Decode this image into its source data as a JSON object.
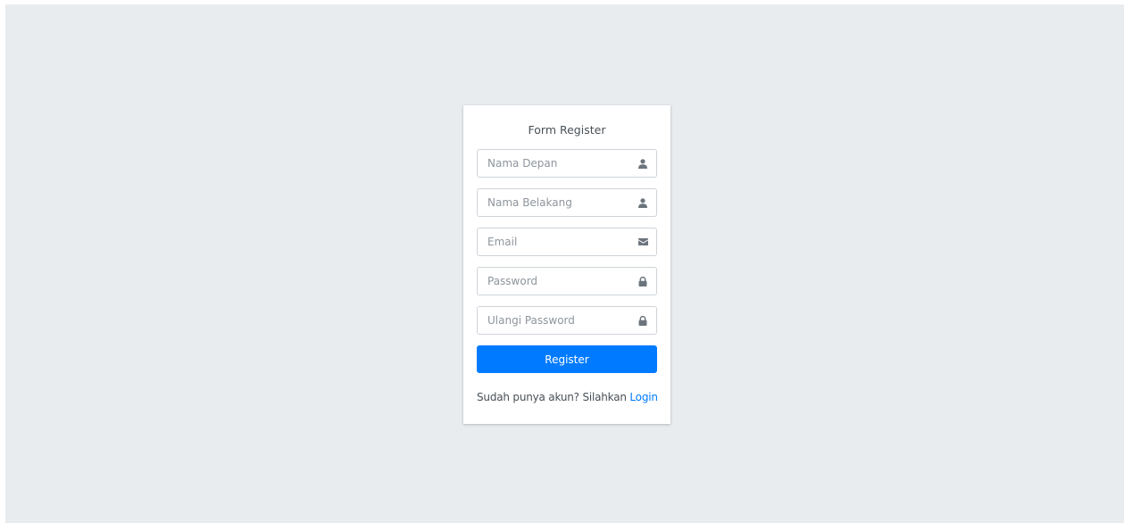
{
  "form": {
    "title": "Form Register",
    "fields": [
      {
        "placeholder": "Nama Depan",
        "icon": "user-icon"
      },
      {
        "placeholder": "Nama Belakang",
        "icon": "user-icon"
      },
      {
        "placeholder": "Email",
        "icon": "envelope-icon"
      },
      {
        "placeholder": "Password",
        "icon": "lock-icon"
      },
      {
        "placeholder": "Ulangi Password",
        "icon": "lock-icon"
      }
    ],
    "submit_label": "Register",
    "footer_text": "Sudah punya akun? Silahkan ",
    "footer_link": "Login"
  },
  "colors": {
    "background": "#e9ecef",
    "primary": "#007bff",
    "icon": "#6c757d"
  }
}
